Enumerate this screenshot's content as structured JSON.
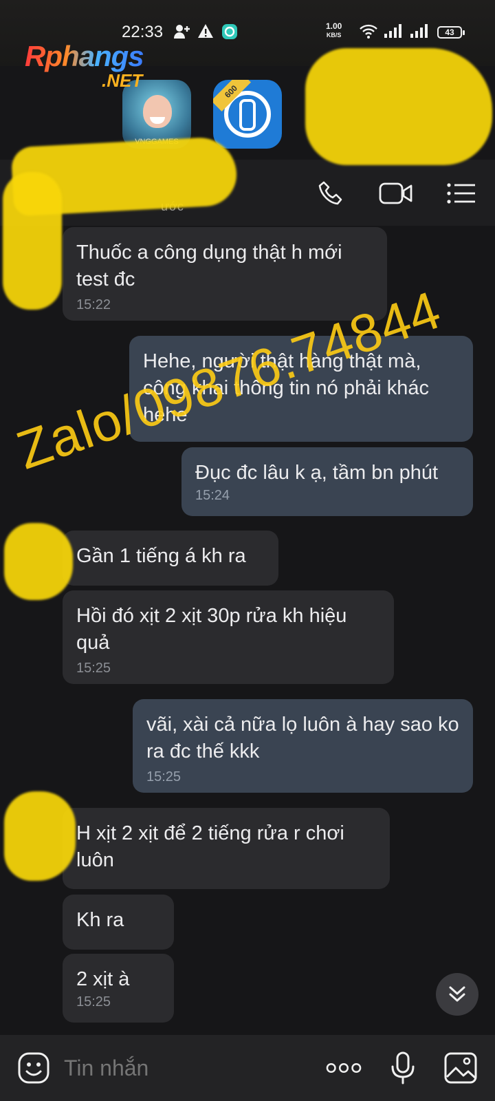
{
  "status_bar": {
    "time": "22:33",
    "net_speed_value": "1.00",
    "net_speed_unit": "KB/S",
    "battery": "43",
    "icons": [
      "person-add-icon",
      "warning-icon",
      "app-notification-icon",
      "wifi-icon",
      "signal-icon",
      "signal-icon"
    ]
  },
  "watermark": {
    "logo_main": "Rphangs",
    "logo_suffix": ".NET",
    "phone": "Zalo/09876.74844"
  },
  "home_shortcuts": [
    {
      "icon": "game-app-icon",
      "label": "VNGGAMES"
    },
    {
      "icon": "traffic-light-app-icon",
      "badge": "600"
    }
  ],
  "header": {
    "contact_status": "ước",
    "actions": [
      "phone-call-icon",
      "video-call-icon",
      "menu-list-icon"
    ]
  },
  "messages": [
    {
      "side": "in",
      "text": "Thuốc a công dụng thật h mới test đc",
      "time": "15:22"
    },
    {
      "side": "out",
      "text": "Hehe, người thật hàng thật mà, công khai thông tin nó phải khác hehe",
      "time": ""
    },
    {
      "side": "out",
      "text": "Đục đc lâu k ạ, tầm bn phút",
      "time": "15:24"
    },
    {
      "side": "in",
      "text": "Gần 1 tiếng á kh ra",
      "time": ""
    },
    {
      "side": "in",
      "text": "Hồi đó xịt 2 xịt 30p rửa kh hiệu quả",
      "time": "15:25"
    },
    {
      "side": "out",
      "text": "vãi, xài cả nữa lọ luôn à hay sao ko ra đc thế kkk",
      "time": "15:25"
    },
    {
      "side": "in",
      "text": "H xịt 2 xịt để 2 tiếng rửa r chơi luôn",
      "time": ""
    },
    {
      "side": "in",
      "text": "Kh ra",
      "time": ""
    },
    {
      "side": "in",
      "text": "2 xịt à",
      "time": "15:25"
    }
  ],
  "composer": {
    "placeholder": "Tin nhắn",
    "icons": [
      "emoji-icon",
      "more-dots-icon",
      "microphone-icon",
      "image-icon"
    ]
  },
  "colors": {
    "background": "#161618",
    "incoming_bubble": "#2b2b2e",
    "outgoing_bubble": "#3a4452",
    "watermark_yellow": "#f8d60a"
  }
}
